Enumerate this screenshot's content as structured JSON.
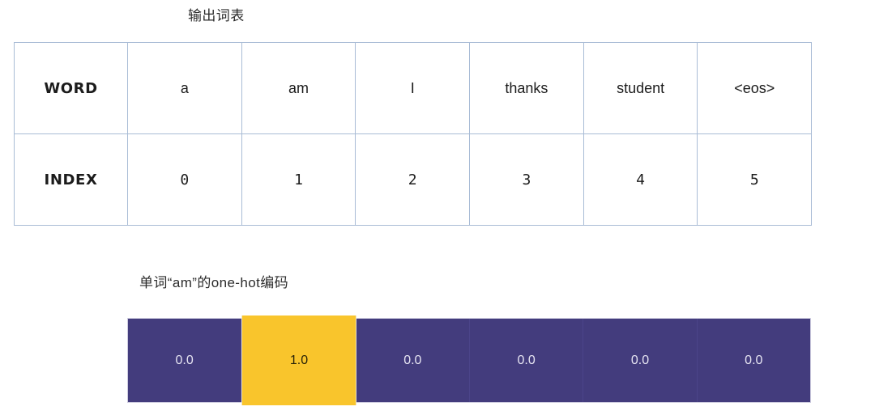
{
  "vocab_section": {
    "title": "输出词表",
    "row_labels": {
      "word": "WORD",
      "index": "INDEX"
    },
    "words": [
      "a",
      "am",
      "I",
      "thanks",
      "student",
      "<eos>"
    ],
    "indices": [
      "0",
      "1",
      "2",
      "3",
      "4",
      "5"
    ]
  },
  "onehot_section": {
    "title": "单词“am”的one-hot编码",
    "encoded_word": "am",
    "values": [
      "0.0",
      "1.0",
      "0.0",
      "0.0",
      "0.0",
      "0.0"
    ],
    "highlight_index": 1,
    "colors": {
      "zero_cell": "#433C7D",
      "one_cell": "#F9C52C",
      "zero_text": "#E6E4F2",
      "one_text": "#2A2408",
      "table_border": "#A9BCD6"
    }
  },
  "chart_data": {
    "type": "table",
    "title": "输出词表",
    "columns": [
      "a",
      "am",
      "I",
      "thanks",
      "student",
      "<eos>"
    ],
    "rows": [
      {
        "name": "WORD",
        "values": [
          "a",
          "am",
          "I",
          "thanks",
          "student",
          "<eos>"
        ]
      },
      {
        "name": "INDEX",
        "values": [
          "0",
          "1",
          "2",
          "3",
          "4",
          "5"
        ]
      }
    ],
    "onehot_vector": {
      "label": "单词“am”的one-hot编码",
      "values": [
        0.0,
        1.0,
        0.0,
        0.0,
        0.0,
        0.0
      ],
      "hot_position": 1
    }
  }
}
